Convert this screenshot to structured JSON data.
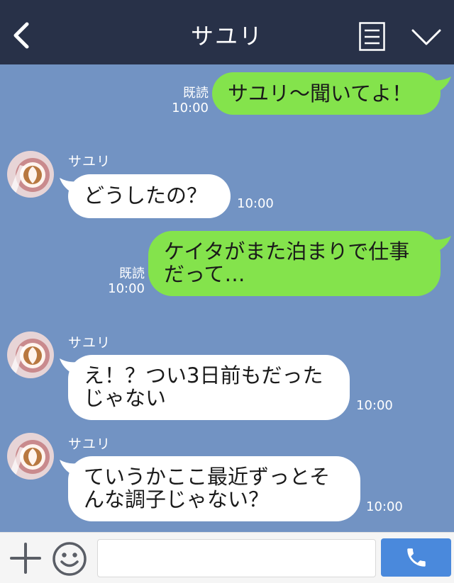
{
  "header": {
    "title": "サユリ",
    "icons": [
      "chevron-left-icon",
      "memo-icon",
      "chevron-down-icon"
    ]
  },
  "messages": [
    {
      "direction": "out",
      "text": "サユリ〜聞いてよ！",
      "read": "既読",
      "time": "10:00"
    },
    {
      "direction": "in",
      "sender": "サユリ",
      "text": "どうしたの？",
      "time": "10:00"
    },
    {
      "direction": "out",
      "line1": "ケイタがまた泊まりで仕事",
      "line2": "だって…",
      "read": "既読",
      "time": "10:00"
    },
    {
      "direction": "in",
      "sender": "サユリ",
      "line1": "え！？つい3日前もだった",
      "line2": "じゃない",
      "time": "10:00"
    },
    {
      "direction": "in",
      "sender": "サユリ",
      "line1": "ていうかここ最近ずっとそ",
      "line2": "んな調子じゃない？",
      "time": "10:00"
    }
  ],
  "input": {
    "value": "",
    "placeholder": ""
  },
  "colors": {
    "header": "#283148",
    "background": "#7293c3",
    "outgoing_bubble": "#84e34c",
    "incoming_bubble": "#ffffff",
    "call_button": "#4a89dc"
  }
}
